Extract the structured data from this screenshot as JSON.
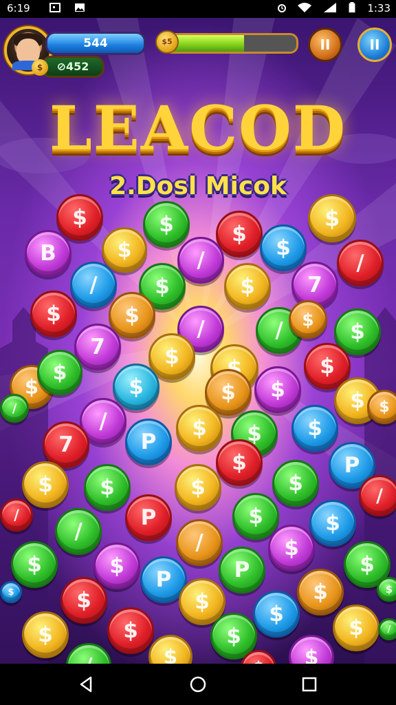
{
  "status_bar": {
    "time": "6:19",
    "right_time": "1:33"
  },
  "hud": {
    "score_blue": "544",
    "score_green": "452",
    "green_prefix": "⊘",
    "coin_badge": "$",
    "progress_icon": "$5",
    "progress_value": 0.6,
    "pause_orange_label": "II",
    "pause_blue_label": "II"
  },
  "title": {
    "logo": "LEACOD",
    "subtitle": "2.Dosl Micok"
  },
  "colors": {
    "red": "#e8202a",
    "green": "#2fbf2a",
    "blue": "#1e9be8",
    "purple": "#c13ad8",
    "gold": "#f2b51f",
    "orange": "#e8951a",
    "cyan": "#2ab7e0"
  },
  "coins": [
    {
      "c": "red",
      "g": "$"
    },
    {
      "c": "green",
      "g": "$"
    },
    {
      "c": "red",
      "g": "$"
    },
    {
      "c": "gold",
      "g": "$"
    },
    {
      "c": "purple",
      "g": "B"
    },
    {
      "c": "gold",
      "g": "$"
    },
    {
      "c": "purple",
      "g": "/"
    },
    {
      "c": "blue",
      "g": "$"
    },
    {
      "c": "red",
      "g": "/"
    },
    {
      "c": "blue",
      "g": "/"
    },
    {
      "c": "green",
      "g": "$"
    },
    {
      "c": "gold",
      "g": "$"
    },
    {
      "c": "purple",
      "g": "7"
    },
    {
      "c": "red",
      "g": "$"
    },
    {
      "c": "orange",
      "g": "$"
    },
    {
      "c": "purple",
      "g": "/"
    },
    {
      "c": "green",
      "g": "/"
    },
    {
      "c": "orange",
      "g": "$"
    },
    {
      "c": "green",
      "g": "$"
    },
    {
      "c": "purple",
      "g": "7"
    },
    {
      "c": "gold",
      "g": "$"
    },
    {
      "c": "gold",
      "g": "$"
    },
    {
      "c": "red",
      "g": "$"
    },
    {
      "c": "orange",
      "g": "$"
    },
    {
      "c": "green",
      "g": "$"
    },
    {
      "c": "cyan",
      "g": "$"
    },
    {
      "c": "orange",
      "g": "$"
    },
    {
      "c": "purple",
      "g": "$"
    },
    {
      "c": "gold",
      "g": "$"
    },
    {
      "c": "orange",
      "g": "$"
    },
    {
      "c": "green",
      "g": "/"
    },
    {
      "c": "purple",
      "g": "/"
    },
    {
      "c": "blue",
      "g": "P"
    },
    {
      "c": "gold",
      "g": "$"
    },
    {
      "c": "green",
      "g": "$"
    },
    {
      "c": "blue",
      "g": "$"
    },
    {
      "c": "red",
      "g": "7"
    },
    {
      "c": "red",
      "g": "$"
    },
    {
      "c": "blue",
      "g": "P"
    },
    {
      "c": "gold",
      "g": "$"
    },
    {
      "c": "green",
      "g": "$"
    },
    {
      "c": "gold",
      "g": "$"
    },
    {
      "c": "green",
      "g": "$"
    },
    {
      "c": "red",
      "g": "/"
    },
    {
      "c": "red",
      "g": "/"
    },
    {
      "c": "green",
      "g": "/"
    },
    {
      "c": "red",
      "g": "P"
    },
    {
      "c": "green",
      "g": "$"
    },
    {
      "c": "blue",
      "g": "$"
    },
    {
      "c": "orange",
      "g": "/"
    },
    {
      "c": "green",
      "g": "$"
    },
    {
      "c": "purple",
      "g": "$"
    },
    {
      "c": "green",
      "g": "$"
    },
    {
      "c": "purple",
      "g": "$"
    },
    {
      "c": "blue",
      "g": "P"
    },
    {
      "c": "green",
      "g": "P"
    },
    {
      "c": "orange",
      "g": "$"
    },
    {
      "c": "green",
      "g": "$"
    },
    {
      "c": "red",
      "g": "$"
    },
    {
      "c": "gold",
      "g": "$"
    },
    {
      "c": "blue",
      "g": "$"
    },
    {
      "c": "gold",
      "g": "$"
    },
    {
      "c": "gold",
      "g": "$"
    },
    {
      "c": "red",
      "g": "$"
    },
    {
      "c": "green",
      "g": "$"
    },
    {
      "c": "purple",
      "g": "$"
    },
    {
      "c": "green",
      "g": "/"
    },
    {
      "c": "gold",
      "g": "$"
    },
    {
      "c": "red",
      "g": "$"
    },
    {
      "c": "blue",
      "g": "$"
    },
    {
      "c": "green",
      "g": "/"
    }
  ]
}
